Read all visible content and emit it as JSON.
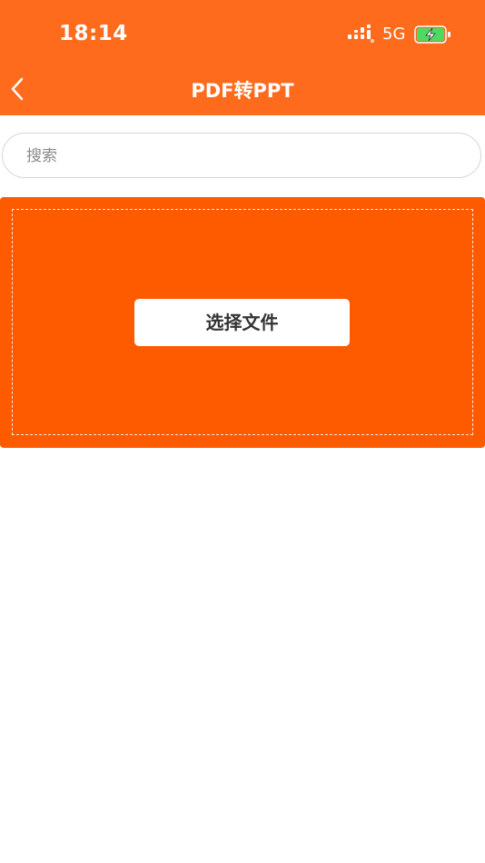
{
  "status_bar": {
    "time": "18:14",
    "network": "5G",
    "icons": [
      "signal-icon",
      "battery-charging-icon"
    ]
  },
  "nav": {
    "title": "PDF转PPT",
    "back_icon": "chevron-left-icon"
  },
  "search": {
    "placeholder": "搜索",
    "value": ""
  },
  "upload": {
    "button_label": "选择文件"
  },
  "colors": {
    "header": "#fe6b1c",
    "upload_area": "#fe5a00",
    "battery_fill": "#4cd964"
  }
}
